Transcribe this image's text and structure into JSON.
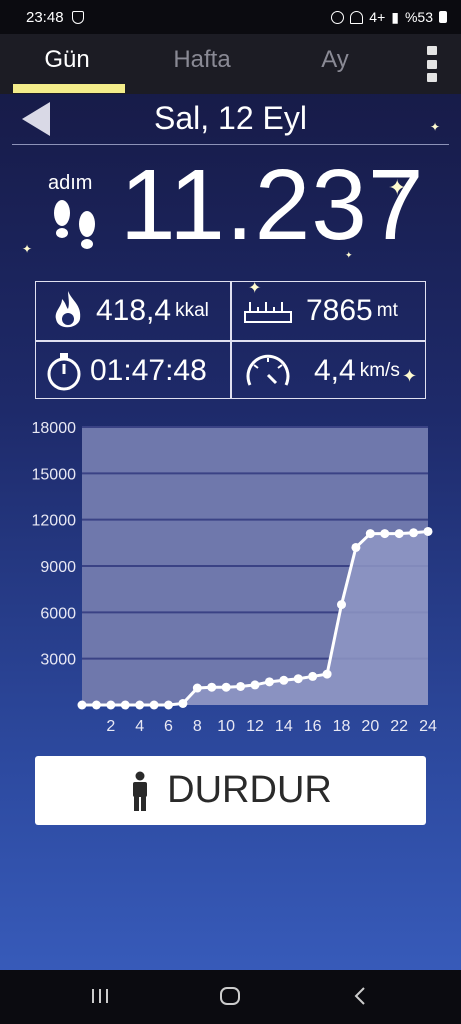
{
  "status_bar": {
    "time": "23:48",
    "battery_text": "%53",
    "signal_text": "4+"
  },
  "tabs": [
    {
      "label": "Gün",
      "active": true
    },
    {
      "label": "Hafta",
      "active": false
    },
    {
      "label": "Ay",
      "active": false
    }
  ],
  "date": {
    "title": "Sal, 12 Eyl"
  },
  "steps": {
    "label": "adım",
    "value": "11.237"
  },
  "stats": {
    "calories": {
      "value": "418,4",
      "unit": "kkal"
    },
    "distance": {
      "value": "7865",
      "unit": "mt"
    },
    "duration": {
      "value": "01:47:48"
    },
    "speed": {
      "value": "4,4",
      "unit": "km/s"
    }
  },
  "chart_data": {
    "type": "line",
    "x": [
      0,
      1,
      2,
      3,
      4,
      5,
      6,
      7,
      8,
      9,
      10,
      11,
      12,
      13,
      14,
      15,
      16,
      17,
      18,
      19,
      20,
      21,
      22,
      23,
      24
    ],
    "values": [
      0,
      0,
      0,
      0,
      0,
      0,
      0,
      100,
      1100,
      1150,
      1150,
      1200,
      1300,
      1500,
      1600,
      1700,
      1850,
      2000,
      6500,
      10200,
      11100,
      11100,
      11100,
      11150,
      11237
    ],
    "ylim": [
      0,
      18000
    ],
    "yticks": [
      "3000",
      "6000",
      "9000",
      "12000",
      "15000",
      "18000"
    ],
    "xticks": [
      "2",
      "4",
      "6",
      "8",
      "10",
      "12",
      "14",
      "16",
      "18",
      "20",
      "22",
      "24"
    ],
    "grid": true,
    "colors": {
      "area": "#8f97c4",
      "line": "#ffffff",
      "grid": "#3a4285"
    }
  },
  "stop_button": {
    "label": "DURDUR"
  },
  "colors": {
    "tab_indicator": "#f3ec8a",
    "background": "#1e2a6a"
  }
}
